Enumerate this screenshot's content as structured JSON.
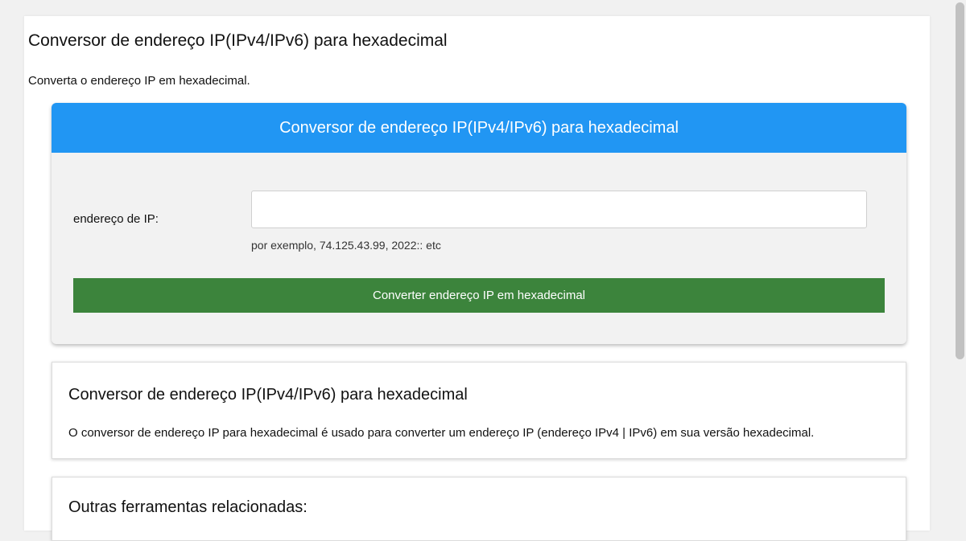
{
  "page": {
    "title": "Conversor de endereço IP(IPv4/IPv6) para hexadecimal",
    "subtitle": "Converta o endereço IP em hexadecimal."
  },
  "tool": {
    "header": "Conversor de endereço IP(IPv4/IPv6) para hexadecimal",
    "ip_label": "endereço de IP:",
    "ip_value": "",
    "ip_hint": "por exemplo, 74.125.43.99, 2022:: etc",
    "button_label": "Converter endereço IP em hexadecimal"
  },
  "info": {
    "title": "Conversor de endereço IP(IPv4/IPv6) para hexadecimal",
    "text": "O conversor de endereço IP para hexadecimal é usado para converter um endereço IP (endereço IPv4 | IPv6) em sua versão hexadecimal."
  },
  "related": {
    "title": "Outras ferramentas relacionadas:"
  },
  "colors": {
    "header_blue": "#2196f3",
    "button_green": "#3c843c"
  }
}
